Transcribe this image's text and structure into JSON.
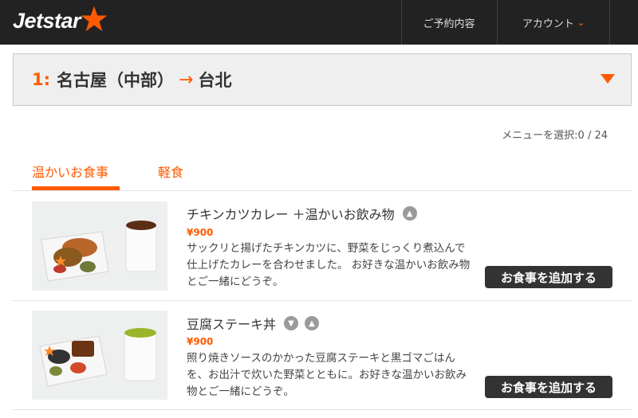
{
  "header": {
    "logo_text": "Jetstar",
    "nav_reservations": "ご予約内容",
    "nav_account": "アカウント",
    "brand_color": "#ff5a00"
  },
  "flight": {
    "number": "1:",
    "origin": "名古屋（中部）",
    "arrow": "→",
    "destination": "台北"
  },
  "menu_selection": {
    "label": "メニューを選択:0 / 24"
  },
  "tabs": [
    {
      "label": "温かいお食事",
      "active": true
    },
    {
      "label": "軽食",
      "active": false
    }
  ],
  "items": [
    {
      "name": "チキンカツカレー ＋温かいお飲み物",
      "price": "¥900",
      "description": "サックリと揚げたチキンカツに、野菜をじっくり煮込んで仕上げたカレーを合わせました。 お好きな温かいお飲み物とご一緒にどうぞ。",
      "add_label": "お食事を追加する",
      "badges": [
        "up-icon"
      ]
    },
    {
      "name": "豆腐ステーキ丼",
      "price": "¥900",
      "description": "照り焼きソースのかかった豆腐ステーキと黒ゴマごはんを、お出汁で炊いた野菜とともに。お好きな温かいお飲み物とご一緒にどうぞ。",
      "add_label": "お食事を追加する",
      "badges": [
        "down-icon",
        "up-icon"
      ]
    }
  ]
}
